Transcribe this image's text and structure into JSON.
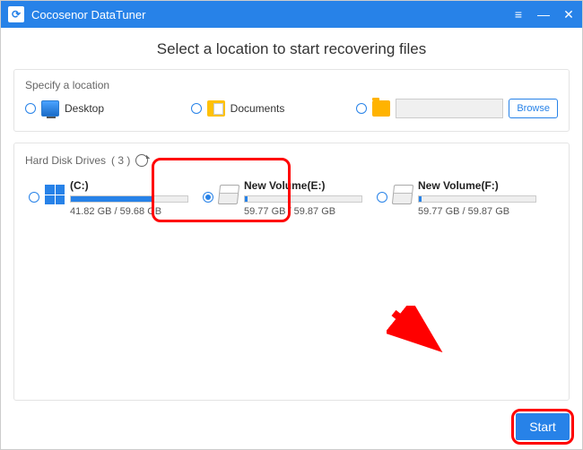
{
  "app": {
    "title": "Cocosenor DataTuner"
  },
  "heading": "Select a location to start recovering files",
  "specify": {
    "title": "Specify a location",
    "desktop": "Desktop",
    "documents": "Documents",
    "browse": "Browse",
    "path": ""
  },
  "drives": {
    "title_prefix": "Hard Disk Drives",
    "count": "( 3 )",
    "list": [
      {
        "name": "(C:)",
        "used_pct": 70,
        "size": "41.82 GB / 59.68 GB",
        "checked": false,
        "os": true
      },
      {
        "name": "New Volume(E:)",
        "used_pct": 2,
        "size": "59.77 GB / 59.87 GB",
        "checked": true,
        "os": false
      },
      {
        "name": "New Volume(F:)",
        "used_pct": 2,
        "size": "59.77 GB / 59.87 GB",
        "checked": false,
        "os": false
      }
    ]
  },
  "start": "Start"
}
